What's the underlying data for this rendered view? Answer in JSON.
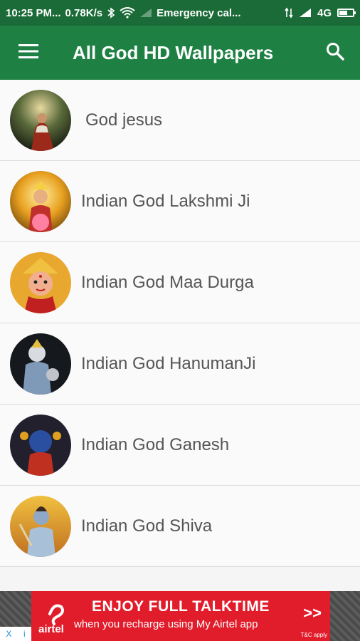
{
  "status_bar": {
    "time": "10:25 PM...",
    "speed": "0.78K/s",
    "carrier": "Emergency cal...",
    "network": "4G",
    "battery_level": 0.6
  },
  "app_bar": {
    "title": "All God HD Wallpapers"
  },
  "list": {
    "items": [
      {
        "label": "God jesus"
      },
      {
        "label": "Indian God Lakshmi Ji"
      },
      {
        "label": "Indian God Maa Durga"
      },
      {
        "label": "Indian God HanumanJi"
      },
      {
        "label": "Indian God Ganesh"
      },
      {
        "label": "Indian God Shiva"
      }
    ]
  },
  "ad": {
    "title": "ENJOY FULL TALKTIME",
    "subtitle": "when you recharge using My Airtel app",
    "brand": "airtel",
    "arrow": ">>",
    "terms": "T&C apply",
    "close_glyph": "X",
    "info_glyph": "i"
  }
}
